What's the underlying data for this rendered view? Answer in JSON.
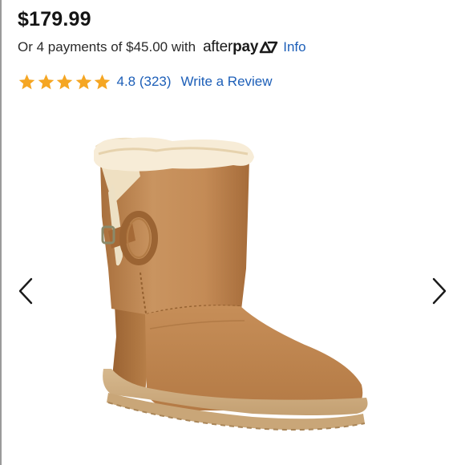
{
  "product": {
    "price": "$179.99",
    "installments_text": "Or 4 payments of $45.00 with",
    "afterpay": {
      "logo_light": "after",
      "logo_bold": "pay",
      "info_label": "Info"
    },
    "rating": {
      "stars": 5,
      "value_text": "4.8 (323)",
      "write_review_label": "Write a Review",
      "star_color": "#f5a623"
    },
    "image": {
      "description_icon": "ugg-boot-image"
    }
  },
  "gallery": {
    "prev_icon": "chevron-left-icon",
    "next_icon": "chevron-right-icon"
  },
  "colors": {
    "link": "#1d5fb8",
    "text": "#1a1a1a",
    "star": "#f5a623",
    "boot": "#c28952"
  }
}
